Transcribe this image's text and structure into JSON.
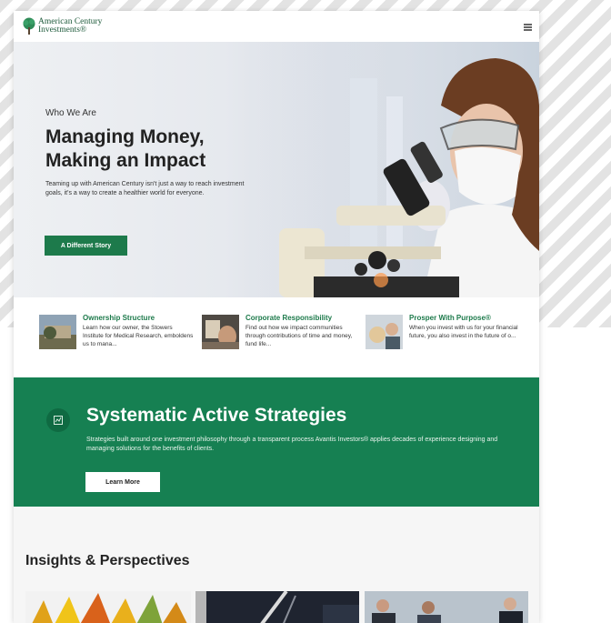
{
  "header": {
    "logo_line1": "American Century",
    "logo_line2": "Investments®"
  },
  "hero": {
    "eyebrow": "Who We Are",
    "title_line1": "Managing Money,",
    "title_line2": "Making an Impact",
    "description": "Teaming up with American Century isn't just a way to reach investment goals, it's a way to create a healthier world for everyone.",
    "button_label": "A Different Story"
  },
  "features": [
    {
      "title": "Ownership Structure",
      "text": "Learn how our owner, the Stowers Institute for Medical Research, emboldens us to mana..."
    },
    {
      "title": "Corporate Responsibility",
      "text": "Find out how we impact communities through contributions of time and money, fund life..."
    },
    {
      "title": "Prosper With Purpose®",
      "text": "When you invest with us for your financial future, you also invest in the future of o..."
    }
  ],
  "strategies": {
    "title": "Systematic Active Strategies",
    "description": "Strategies built around one investment philosophy through a transparent process Avantis Investors® applies decades of experience designing and managing solutions for the benefits of clients.",
    "button_label": "Learn More"
  },
  "insights": {
    "title": "Insights & Perspectives"
  },
  "colors": {
    "brand_green": "#1d7a4b",
    "band_green": "#168052"
  }
}
